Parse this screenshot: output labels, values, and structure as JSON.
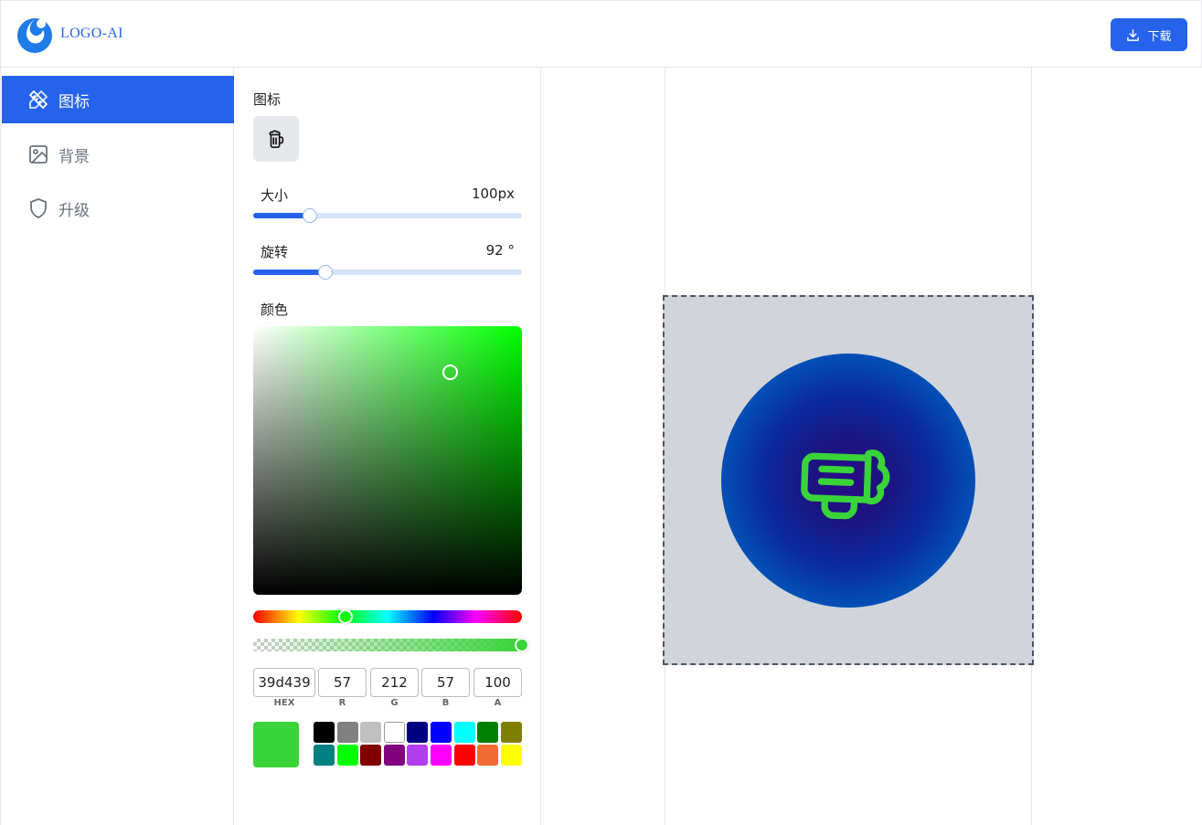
{
  "header": {
    "logo_text": "LOGO-AI",
    "download_label": "下载"
  },
  "sidebar": {
    "items": [
      {
        "label": "图标",
        "icon": "pencil-ruler-icon",
        "active": true
      },
      {
        "label": "背景",
        "icon": "image-icon",
        "active": false
      },
      {
        "label": "升级",
        "icon": "shield-icon",
        "active": false
      }
    ]
  },
  "panel": {
    "icon_label": "图标",
    "selected_icon": "beer-mug-icon",
    "size": {
      "label": "大小",
      "value": "100px",
      "fraction": 0.21
    },
    "rotation": {
      "label": "旋转",
      "value": "92 °",
      "fraction": 0.27
    },
    "color_label": "颜色",
    "color_picker": {
      "hue_color": "#00ff00",
      "hue_fraction": 0.345,
      "saturation_fraction": 0.73,
      "value_fraction": 0.83,
      "alpha_fraction": 1.0,
      "hex": "39d439",
      "r": "57",
      "g": "212",
      "b": "57",
      "a": "100",
      "labels": {
        "hex": "HEX",
        "r": "R",
        "g": "G",
        "b": "B",
        "a": "A"
      },
      "current_color": "#39d439"
    },
    "swatches": [
      "#000000",
      "#808080",
      "#c0c0c0",
      "#ffffff",
      "#000080",
      "#0000ff",
      "#00ffff",
      "#008000",
      "#808000",
      "#008080",
      "#00ff00",
      "#800000",
      "#800080",
      "#b13cf0",
      "#ff00ff",
      "#ff0000",
      "#f26b32",
      "#ffff00"
    ]
  },
  "preview": {
    "background_color": "#d1d5db",
    "icon_color": "#39d439",
    "icon": "beer-mug-icon"
  },
  "colors": {
    "accent": "#2563eb"
  }
}
